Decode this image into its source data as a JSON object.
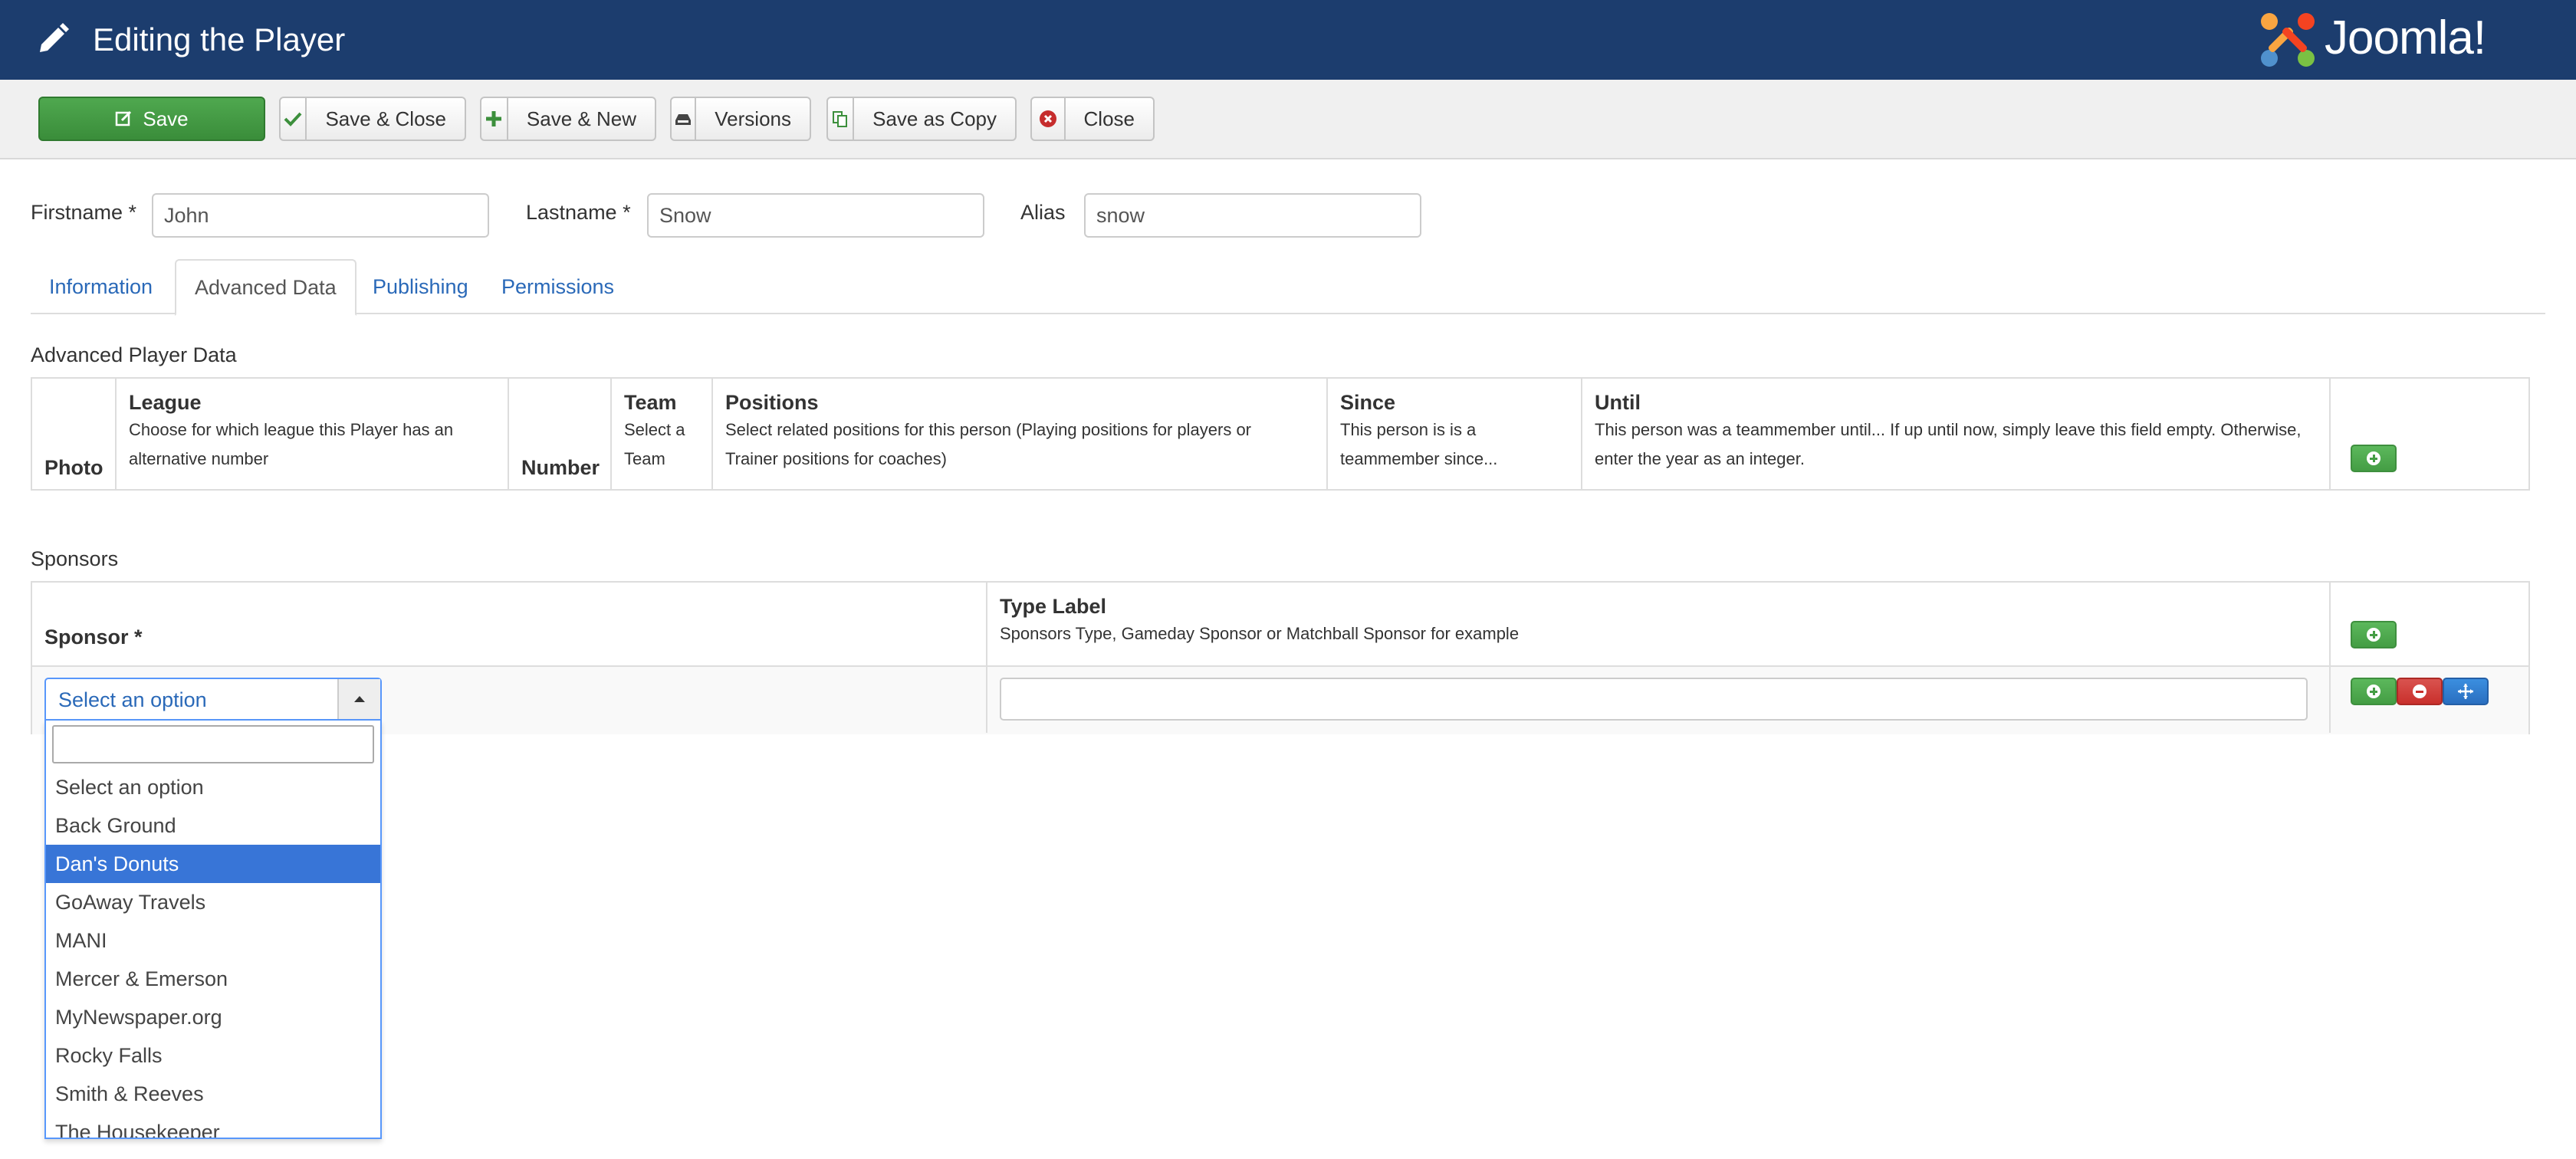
{
  "header": {
    "title": "Editing the Player",
    "logo_text": "Joomla!",
    "icon": "pencil-icon"
  },
  "toolbar": {
    "save": "Save",
    "save_close": "Save & Close",
    "save_new": "Save & New",
    "versions": "Versions",
    "save_copy": "Save as Copy",
    "close": "Close"
  },
  "fields": {
    "firstname_label": "Firstname *",
    "firstname_value": "John",
    "lastname_label": "Lastname *",
    "lastname_value": "Snow",
    "alias_label": "Alias",
    "alias_value": "snow"
  },
  "tabs": [
    "Information",
    "Advanced Data",
    "Publishing",
    "Permissions"
  ],
  "active_tab": "Advanced Data",
  "advanced": {
    "title": "Advanced Player Data",
    "photo": "Photo",
    "league_h": "League",
    "league_d1": "Choose for which league this Player has an",
    "league_d2": "alternative number",
    "number": "Number",
    "team_h": "Team",
    "team_d1": "Select a",
    "team_d2": "Team",
    "positions_h": "Positions",
    "positions_d1": "Select related positions for this person (Playing positions for players or",
    "positions_d2": "Trainer positions for coaches)",
    "since_h": "Since",
    "since_d1": "This person is is a",
    "since_d2": "teammember since...",
    "until_h": "Until",
    "until_d1": "This person was a teammember until... If up until now, simply leave this field empty. Otherwise,",
    "until_d2": "enter the year as an integer."
  },
  "sponsors": {
    "title": "Sponsors",
    "sponsor_h": "Sponsor *",
    "type_h": "Type Label",
    "type_d": "Sponsors Type, Gameday Sponsor or Matchball Sponsor for example",
    "select_value": "Select an option",
    "search_value": "",
    "options": [
      "Select an option",
      "Back Ground",
      "Dan's Donuts",
      "GoAway Travels",
      "MANI",
      "Mercer & Emerson",
      "MyNewspaper.org",
      "Rocky Falls",
      "Smith & Reeves",
      "The Housekeeper"
    ],
    "highlighted": "Dan's Donuts",
    "type_value": ""
  },
  "colors": {
    "header_bg": "#1c3d6e",
    "save_green": "#449d44",
    "link_blue": "#2a69b8",
    "highlight": "#3875d7"
  }
}
